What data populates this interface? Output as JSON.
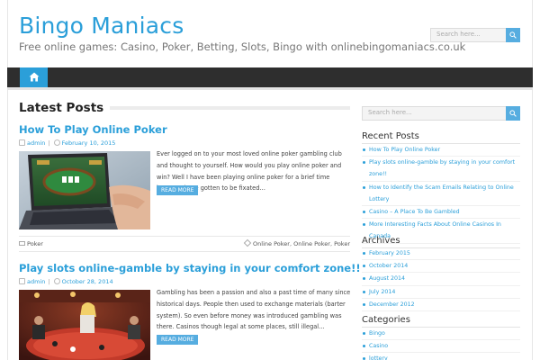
{
  "site": {
    "title": "Bingo Maniacs",
    "tagline": "Free online games: Casino, Poker, Betting, Slots, Bingo with onlinebingomaniacs.co.uk"
  },
  "header_search": {
    "placeholder": "Search here..."
  },
  "nav": {
    "home_icon": "home-icon"
  },
  "main": {
    "section_title": "Latest Posts",
    "read_more": "READ MORE",
    "posts": [
      {
        "title": "How To Play Online Poker",
        "author": "admin",
        "date": "February 10, 2015",
        "excerpt": "Ever logged on to your most loved online poker gambling club and thought to yourself. How would you play online poker and win? Well I have been playing online poker for a brief time however have gotten to be fixated…",
        "category": "Poker",
        "tags": [
          "Online Poker",
          "Online Poker",
          "Poker"
        ]
      },
      {
        "title": "Play slots online-gamble by staying in your comfort zone!!",
        "author": "admin",
        "date": "October 28, 2014",
        "excerpt": "Gambling has been a passion and also a past time of many since historical days. People then used to exchange materials (barter system). So even before money was introduced gambling was there. Casinos though legal at some places, still illegal…"
      }
    ]
  },
  "sidebar": {
    "search_placeholder": "Search here...",
    "recent_posts": {
      "title": "Recent Posts",
      "items": [
        "How To Play Online Poker",
        "Play slots online-gamble by staying in your comfort zone!!",
        "How to Identify the Scam Emails Relating to Online Lottery",
        "Casino – A Place To Be Gambled",
        "More Interesting Facts About Online Casinos In Canada"
      ]
    },
    "archives": {
      "title": "Archives",
      "items": [
        "February 2015",
        "October 2014",
        "August 2014",
        "July 2014",
        "December 2012"
      ]
    },
    "categories": {
      "title": "Categories",
      "items": [
        "Bingo",
        "Casino",
        "lottery"
      ]
    }
  },
  "colors": {
    "accent": "#2b9fd9",
    "nav_bg": "#2e2e2e",
    "button": "#56ade0"
  }
}
